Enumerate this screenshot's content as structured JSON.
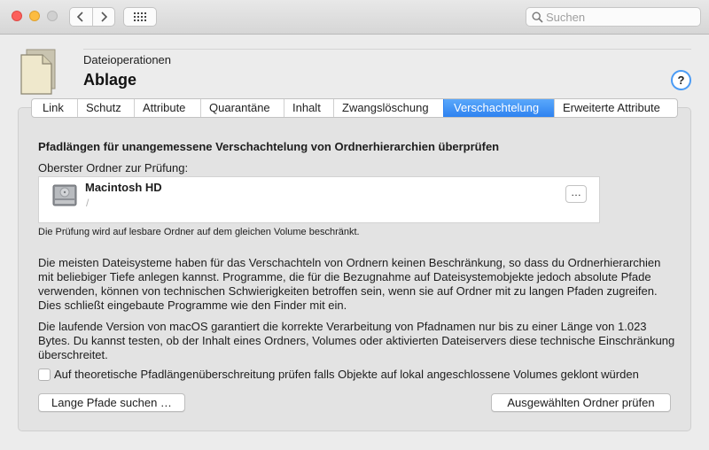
{
  "toolbar": {
    "search_placeholder": "Suchen",
    "icons": {
      "back": "chevron-left-icon",
      "forward": "chevron-right-icon",
      "grid": "grid-icon",
      "search": "magnifier-icon"
    }
  },
  "header": {
    "subtitle": "Dateioperationen",
    "title": "Ablage",
    "help_label": "?"
  },
  "tabs": [
    {
      "label": "Link",
      "active": false
    },
    {
      "label": "Schutz",
      "active": false
    },
    {
      "label": "Attribute",
      "active": false
    },
    {
      "label": "Quarantäne",
      "active": false
    },
    {
      "label": "Inhalt",
      "active": false
    },
    {
      "label": "Zwangslöschung",
      "active": false
    },
    {
      "label": "Verschachtelung",
      "active": true
    },
    {
      "label": "Erweiterte Attribute",
      "active": false
    }
  ],
  "content": {
    "section_title": "Pfadlängen für unangemessene Verschachtelung von Ordnerhierarchien überprüfen",
    "folder_label": "Oberster Ordner zur Prüfung:",
    "volume": {
      "name": "Macintosh HD",
      "path": "/",
      "more_button": "…"
    },
    "volume_note": "Die Prüfung wird auf lesbare Ordner auf dem gleichen Volume beschränkt.",
    "paragraph1": "Die meisten Dateisysteme haben für das Verschachteln von Ordnern keinen Beschränkung, so dass du Ordnerhierarchien mit beliebiger Tiefe anlegen kannst. Programme, die für die Bezugnahme auf Dateisystemobjekte jedoch absolute Pfade verwenden, können von technischen Schwierigkeiten betroffen sein, wenn sie auf Ordner mit zu langen Pfaden zugreifen. Dies schließt eingebaute Programme wie den Finder mit ein.",
    "paragraph2": "Die laufende Version von macOS garantiert die korrekte Verarbeitung von Pfadnamen nur bis zu einer Länge von 1.023 Bytes. Du kannst testen, ob der Inhalt eines Ordners, Volumes oder aktivierten Dateiservers diese technische Einschränkung überschreitet.",
    "checkbox_label": "Auf theoretische Pfadlängenüberschreitung prüfen falls Objekte auf lokal angeschlossene Volumes geklont würden",
    "checkbox_checked": false,
    "button_find_long": "Lange Pfade suchen …",
    "button_check_selected": "Ausgewählten Ordner prüfen"
  },
  "colors": {
    "accent": "#3d8ff5",
    "window_bg": "#ececec",
    "panel_bg": "#e3e3e3"
  }
}
